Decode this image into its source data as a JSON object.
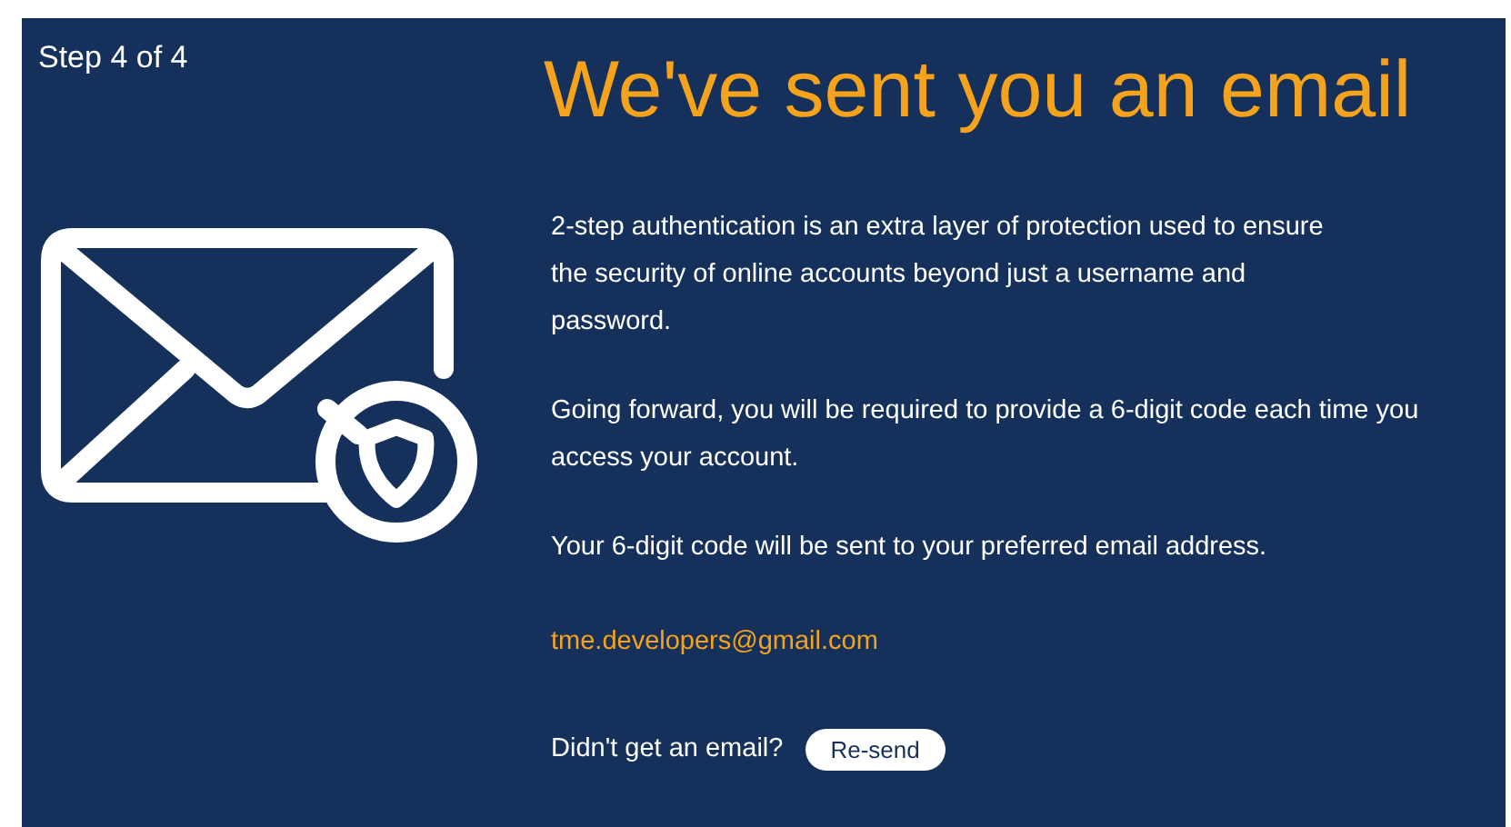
{
  "step_label": "Step 4 of 4",
  "title": "We've sent you an email",
  "paragraphs": [
    "2-step authentication is an extra layer of protection used to ensure the security of online accounts beyond just a username and password.",
    "Going forward, you will be required to provide a 6-digit code each time you access your account.",
    "Your 6-digit code will be sent to your preferred email address."
  ],
  "email": "tme.developers@gmail.com",
  "resend_prompt": "Didn't get an email?",
  "resend_button": "Re-send"
}
